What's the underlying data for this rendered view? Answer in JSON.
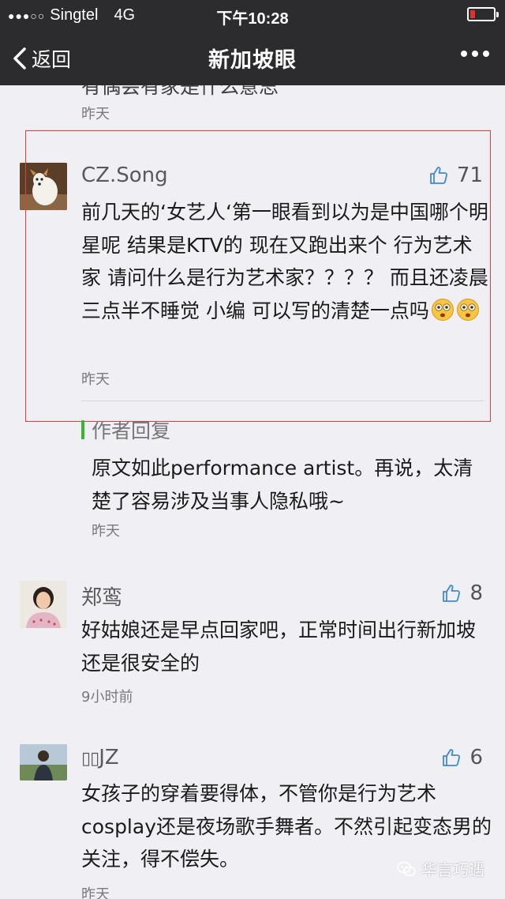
{
  "status_bar": {
    "carrier": "Singtel",
    "network": "4G",
    "time": "下午10:28",
    "battery_level": 0.2,
    "battery_color": "#e0332d"
  },
  "nav": {
    "back_label": "返回",
    "title": "新加坡眼"
  },
  "partial_top": {
    "text": "有偶会有家是什么意思",
    "time": "昨天"
  },
  "comments": [
    {
      "author": "CZ.Song",
      "likes": "71",
      "text": "前几天的‘女艺人‘第一眼看到以为是中国哪个明星呢 结果是KTV的 现在又跑出来个 行为艺术家 请问什么是行为艺术家？？？？ 而且还凌晨三点半不睡觉 小编 可以写的清楚一点吗",
      "time": "昨天",
      "reply": {
        "label": "作者回复",
        "text": "原文如此performance artist。再说，太清楚了容易涉及当事人隐私哦~",
        "time": "昨天"
      }
    },
    {
      "author": "郑鸾",
      "likes": "8",
      "text": "好姑娘还是早点回家吧，正常时间出行新加坡还是很安全的",
      "time": "9小时前"
    },
    {
      "author": "JZ",
      "likes": "6",
      "text": "女孩子的穿着要得体，不管你是行为艺术cosplay还是夜场歌手舞者。不然引起变态男的关注，得不偿失。",
      "time": "昨天"
    }
  ],
  "watermark": "华言巧遇",
  "colors": {
    "bar_bg": "#2c2c2e",
    "page_bg": "#efeff4",
    "highlight": "#e43b3b",
    "reply_accent": "#38b432"
  }
}
